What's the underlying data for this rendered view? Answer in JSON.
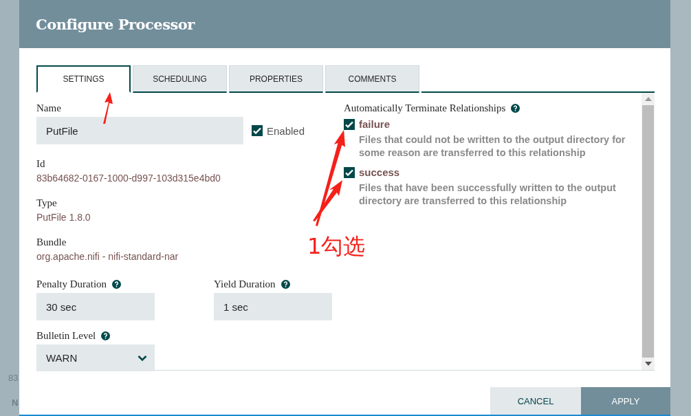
{
  "background": {
    "texts": [
      "83",
      "N"
    ]
  },
  "dialog": {
    "title": "Configure Processor",
    "tabs": [
      {
        "label": "SETTINGS",
        "selected": true
      },
      {
        "label": "SCHEDULING",
        "selected": false
      },
      {
        "label": "PROPERTIES",
        "selected": false
      },
      {
        "label": "COMMENTS",
        "selected": false
      }
    ],
    "name": {
      "label": "Name",
      "value": "PutFile"
    },
    "enabled": {
      "label": "Enabled",
      "checked": true
    },
    "details": [
      {
        "label": "Id",
        "value": "83b64682-0167-1000-d997-103d315e4bd0"
      },
      {
        "label": "Type",
        "value": "PutFile 1.8.0"
      },
      {
        "label": "Bundle",
        "value": "org.apache.nifi - nifi-standard-nar"
      }
    ],
    "durations": [
      {
        "label": "Penalty Duration",
        "value": "30 sec"
      },
      {
        "label": "Yield Duration",
        "value": "1 sec"
      }
    ],
    "bulletin_level": {
      "label": "Bulletin Level",
      "value": "WARN"
    },
    "relationships": {
      "title": "Automatically Terminate Relationships",
      "items": [
        {
          "name": "failure",
          "checked": true,
          "description": "Files that could not be written to the output directory for some reason are transferred to this relationship"
        },
        {
          "name": "success",
          "checked": true,
          "description": "Files that have been successfully written to the output directory are transferred to this relationship"
        }
      ]
    },
    "buttons": [
      {
        "label": "CANCEL",
        "kind": "secondary"
      },
      {
        "label": "APPLY",
        "kind": "primary"
      }
    ]
  },
  "annotation": {
    "text": "1勾选"
  }
}
